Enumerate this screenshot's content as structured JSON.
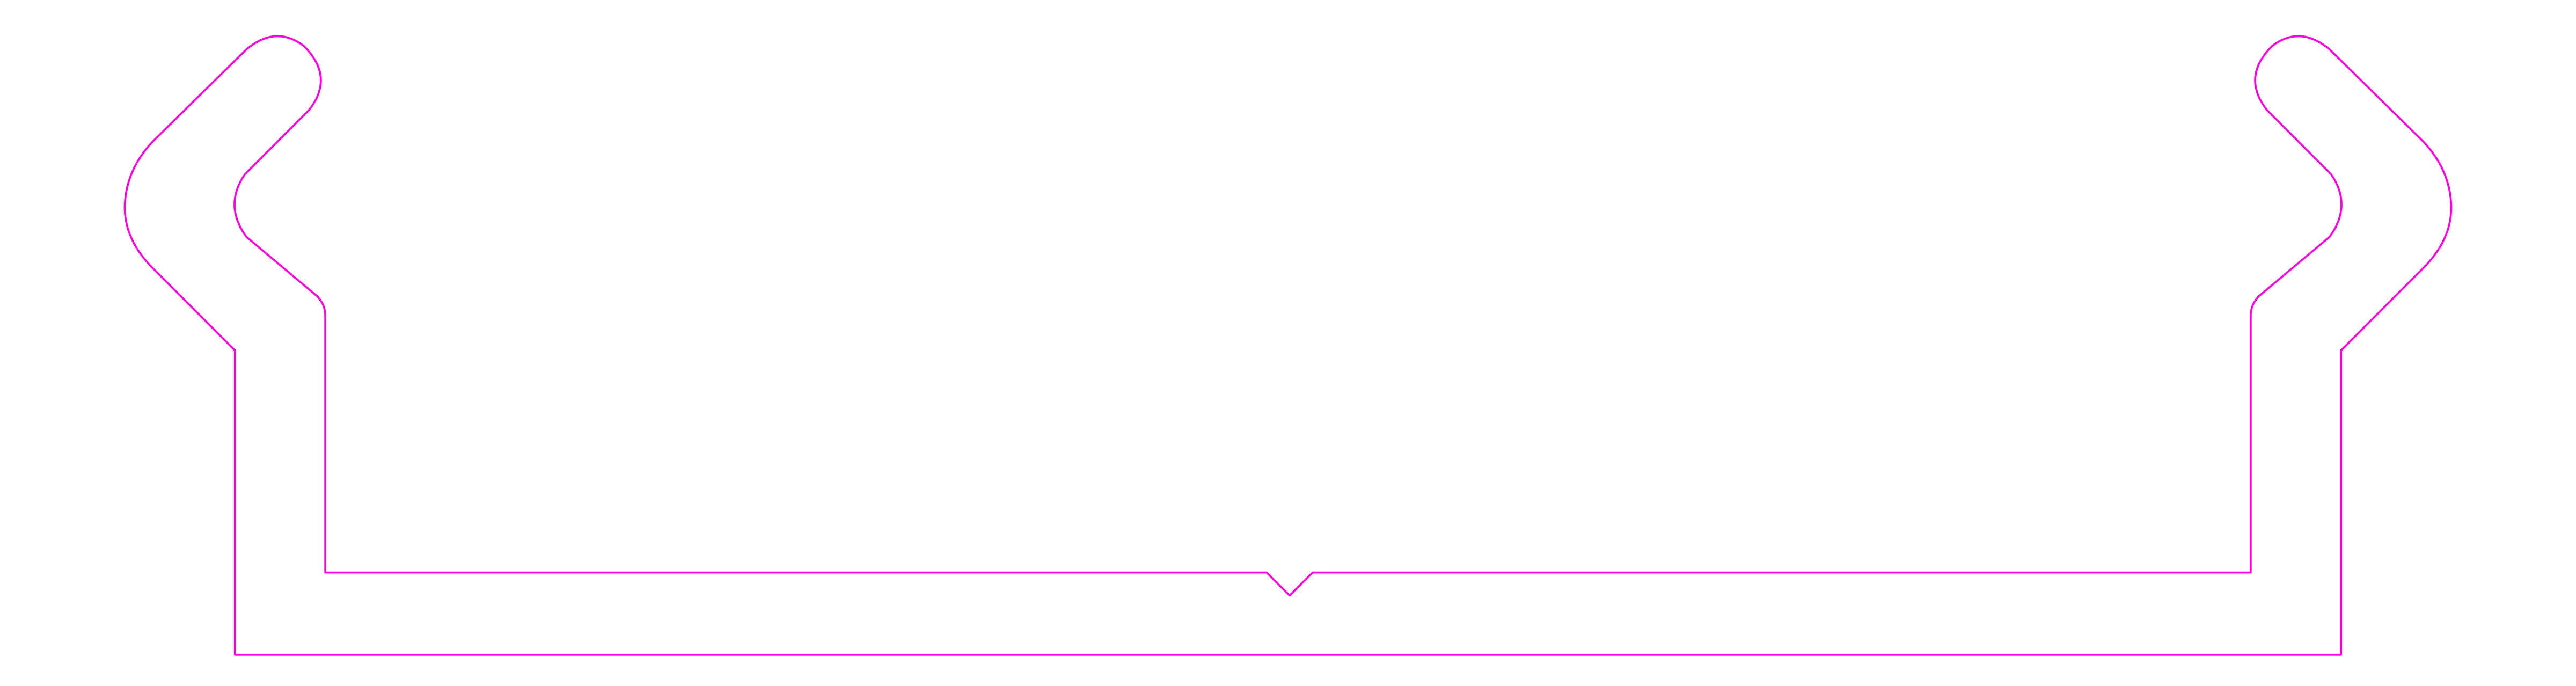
{
  "drawing": {
    "stroke_color": "#ff00dd",
    "background_color": "#ffffff"
  }
}
